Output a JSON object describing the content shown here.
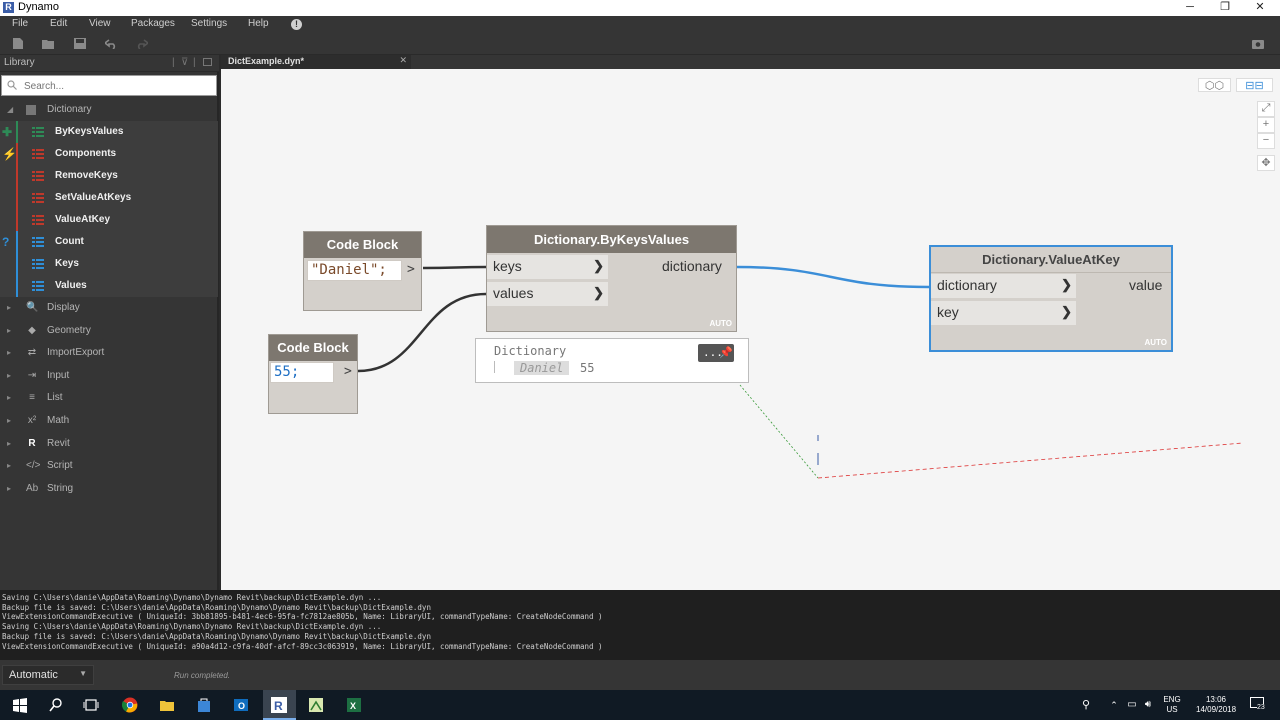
{
  "window": {
    "title": "Dynamo",
    "controls": [
      "─",
      "❐",
      "✕"
    ]
  },
  "menu": [
    "File",
    "Edit",
    "View",
    "Packages",
    "Settings",
    "Help"
  ],
  "library": {
    "header": "Library",
    "search_placeholder": "Search...",
    "expanded_category": "Dictionary",
    "dictionary_items": [
      {
        "label": "ByKeysValues",
        "type": "create"
      },
      {
        "label": "Components",
        "type": "action"
      },
      {
        "label": "RemoveKeys",
        "type": "action"
      },
      {
        "label": "SetValueAtKeys",
        "type": "action"
      },
      {
        "label": "ValueAtKey",
        "type": "action"
      },
      {
        "label": "Count",
        "type": "query"
      },
      {
        "label": "Keys",
        "type": "query"
      },
      {
        "label": "Values",
        "type": "query"
      }
    ],
    "categories": [
      "Display",
      "Geometry",
      "ImportExport",
      "Input",
      "List",
      "Math",
      "Revit",
      "Script",
      "String"
    ],
    "category_icons": [
      "🔍",
      "◆",
      "⇄",
      "⇥",
      "≡",
      "x²",
      "R",
      "</>",
      "Ab"
    ]
  },
  "tab": {
    "file_name": "DictExample.dyn*"
  },
  "nodes": {
    "code_block_1": {
      "title": "Code Block",
      "code": "\"Daniel\";",
      "output": ">"
    },
    "code_block_2": {
      "title": "Code Block",
      "code": "55;",
      "output": ">"
    },
    "by_keys_values": {
      "title": "Dictionary.ByKeysValues",
      "inputs": [
        "keys",
        "values"
      ],
      "output": "dictionary",
      "lacing": "AUTO"
    },
    "value_at_key": {
      "title": "Dictionary.ValueAtKey",
      "inputs": [
        "dictionary",
        "key"
      ],
      "output": "value",
      "lacing": "AUTO"
    }
  },
  "preview": {
    "type_label": "Dictionary",
    "key": "Daniel",
    "value": "55",
    "menu_label": "..."
  },
  "console": {
    "lines": [
      "Saving C:\\Users\\danie\\AppData\\Roaming\\Dynamo\\Dynamo Revit\\backup\\DictExample.dyn ...",
      "Backup file is saved: C:\\Users\\danie\\AppData\\Roaming\\Dynamo\\Dynamo Revit\\backup\\DictExample.dyn",
      "ViewExtensionCommandExecutive ( UniqueId: 3bb81895-b481-4ec6-95fa-fc7812ae805b, Name: LibraryUI, commandTypeName: CreateNodeCommand )",
      "Saving C:\\Users\\danie\\AppData\\Roaming\\Dynamo\\Dynamo Revit\\backup\\DictExample.dyn ...",
      "Backup file is saved: C:\\Users\\danie\\AppData\\Roaming\\Dynamo\\Dynamo Revit\\backup\\DictExample.dyn",
      "ViewExtensionCommandExecutive ( UniqueId: a90a4d12-c9fa-40df-afcf-89cc3c063919, Name: LibraryUI, commandTypeName: CreateNodeCommand )"
    ]
  },
  "status": {
    "run_mode": "Automatic",
    "run_status": "Run completed."
  },
  "taskbar": {
    "language": "ENG",
    "region": "US",
    "time": "13:06",
    "date": "14/09/2018",
    "notification_count": "23"
  },
  "colors": {
    "wire_selected": "#3b8ed8",
    "node_header": "#7d776f",
    "selection_border": "#3b8ed8"
  }
}
